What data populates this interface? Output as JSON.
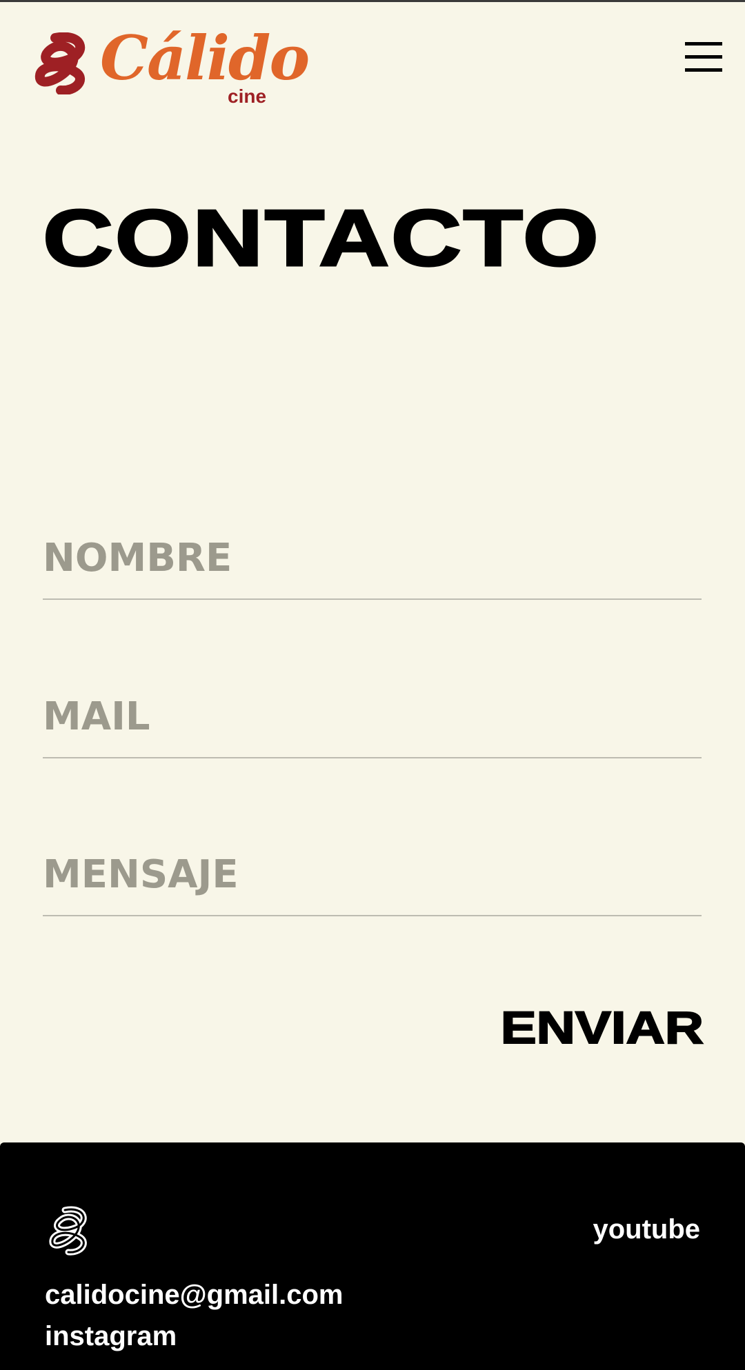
{
  "header": {
    "brand_name": "Cálido",
    "brand_sub": "cine",
    "menu_icon": "hamburger-menu-icon"
  },
  "page": {
    "title": "CONTACTO"
  },
  "form": {
    "name_placeholder": "NOMBRE",
    "mail_placeholder": "MAIL",
    "message_placeholder": "MENSAJE",
    "submit_label": "ENVIAR"
  },
  "footer": {
    "logo_icon": "calido-swirl-icon",
    "youtube": "youtube",
    "email": "calidocine@gmail.com",
    "instagram": "instagram"
  },
  "colors": {
    "background": "#f8f6e8",
    "brand_orange": "#e0662a",
    "brand_red": "#9e2024",
    "placeholder": "#9c9a8d",
    "footer_bg": "#000000"
  }
}
